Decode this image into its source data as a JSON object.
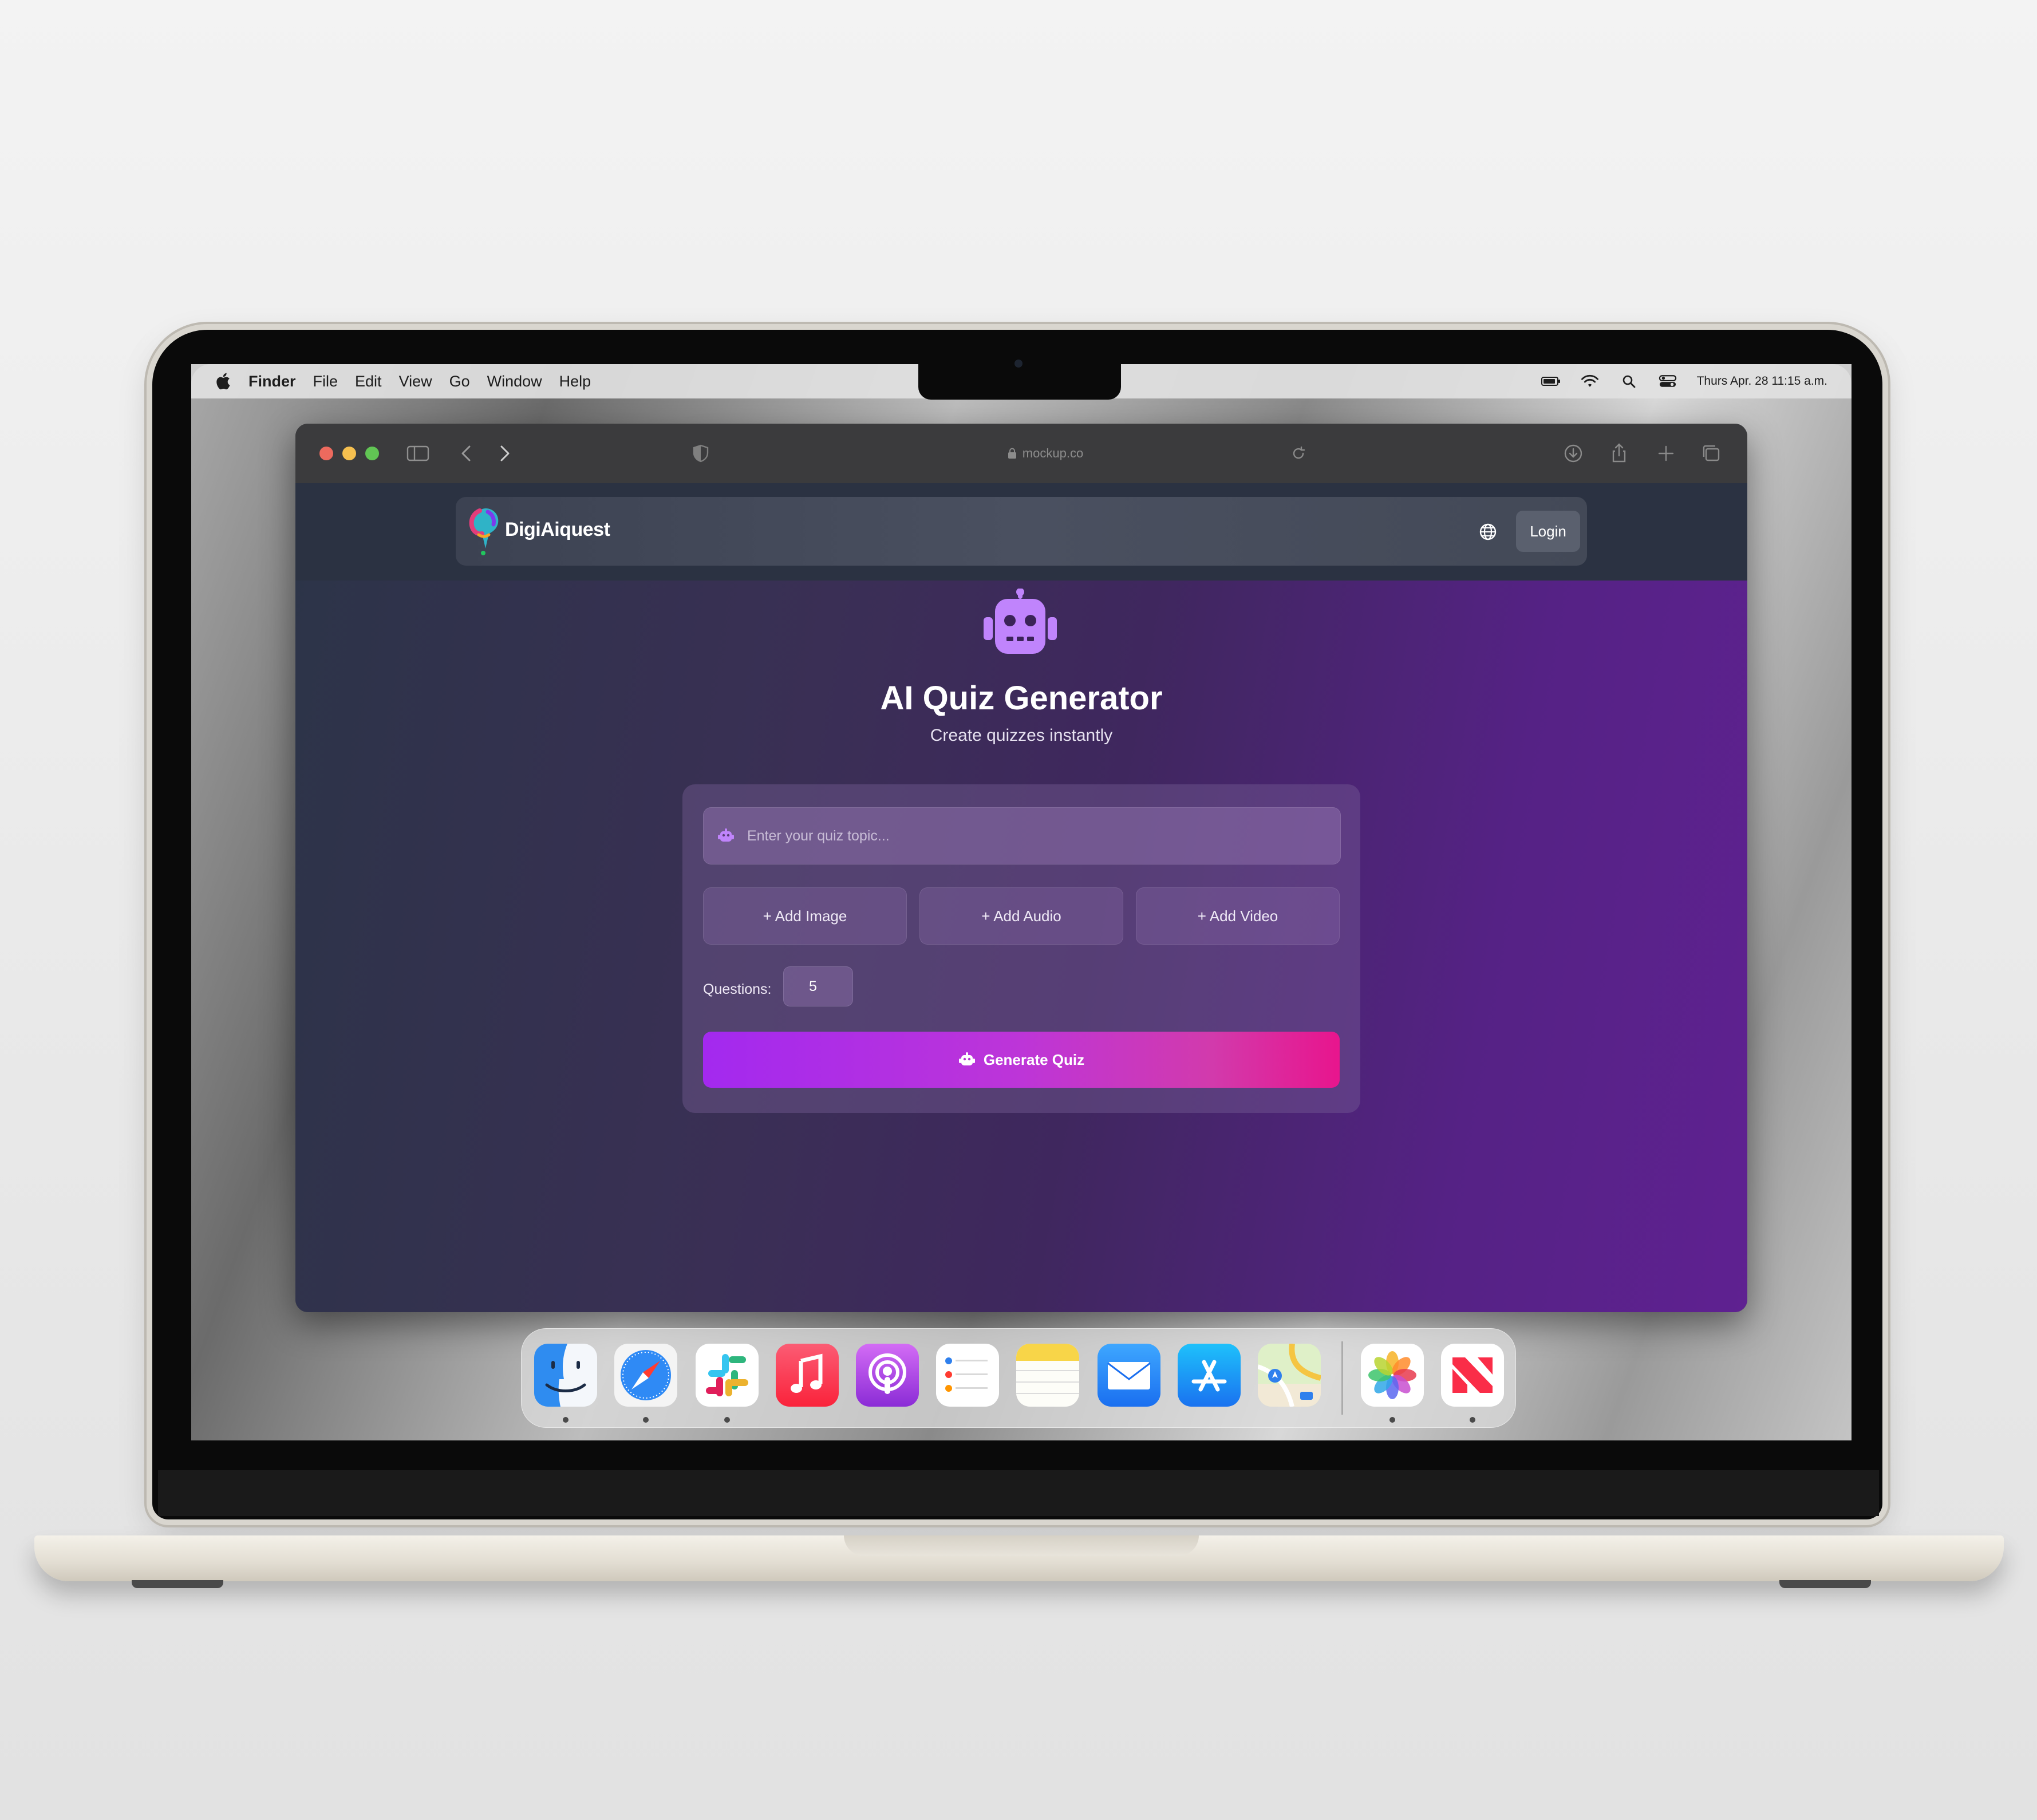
{
  "menubar": {
    "app_name": "Finder",
    "items": [
      "File",
      "Edit",
      "View",
      "Go",
      "Window",
      "Help"
    ],
    "datetime": "Thurs Apr. 28 11:15 a.m.",
    "status_icons": [
      "battery-icon",
      "wifi-icon",
      "search-icon",
      "control-center-icon"
    ]
  },
  "browser": {
    "url": "mockup.co",
    "toolbar_icons": [
      "sidebar-icon",
      "back-icon",
      "forward-icon",
      "shield-icon",
      "reload-icon",
      "download-icon",
      "share-icon",
      "new-tab-icon",
      "tabs-icon"
    ]
  },
  "nav": {
    "brand": "DigiAiquest",
    "login_label": "Login",
    "globe_icon": "globe-icon"
  },
  "hero": {
    "title": "AI Quiz Generator",
    "subtitle": "Create quizzes instantly",
    "icon": "robot-icon"
  },
  "form": {
    "topic_placeholder": "Enter your quiz topic...",
    "topic_value": "",
    "add_image_label": "+ Add Image",
    "add_audio_label": "+ Add Audio",
    "add_video_label": "+ Add Video",
    "questions_label": "Questions:",
    "questions_value": "5",
    "generate_label": "Generate Quiz"
  },
  "dock": {
    "apps": [
      "Finder",
      "Safari",
      "Slack",
      "Music",
      "Podcasts",
      "Reminders",
      "Notes",
      "Mail",
      "App Store",
      "Maps",
      "Photos",
      "News"
    ],
    "running": [
      "Finder",
      "Safari",
      "Slack",
      "Photos",
      "News"
    ]
  },
  "colors": {
    "page_gradient_start": "#2c3448",
    "page_gradient_end": "#5f2191",
    "generate_start": "#a329ef",
    "generate_end": "#e8158d",
    "robot_icon": "#c084fc"
  }
}
